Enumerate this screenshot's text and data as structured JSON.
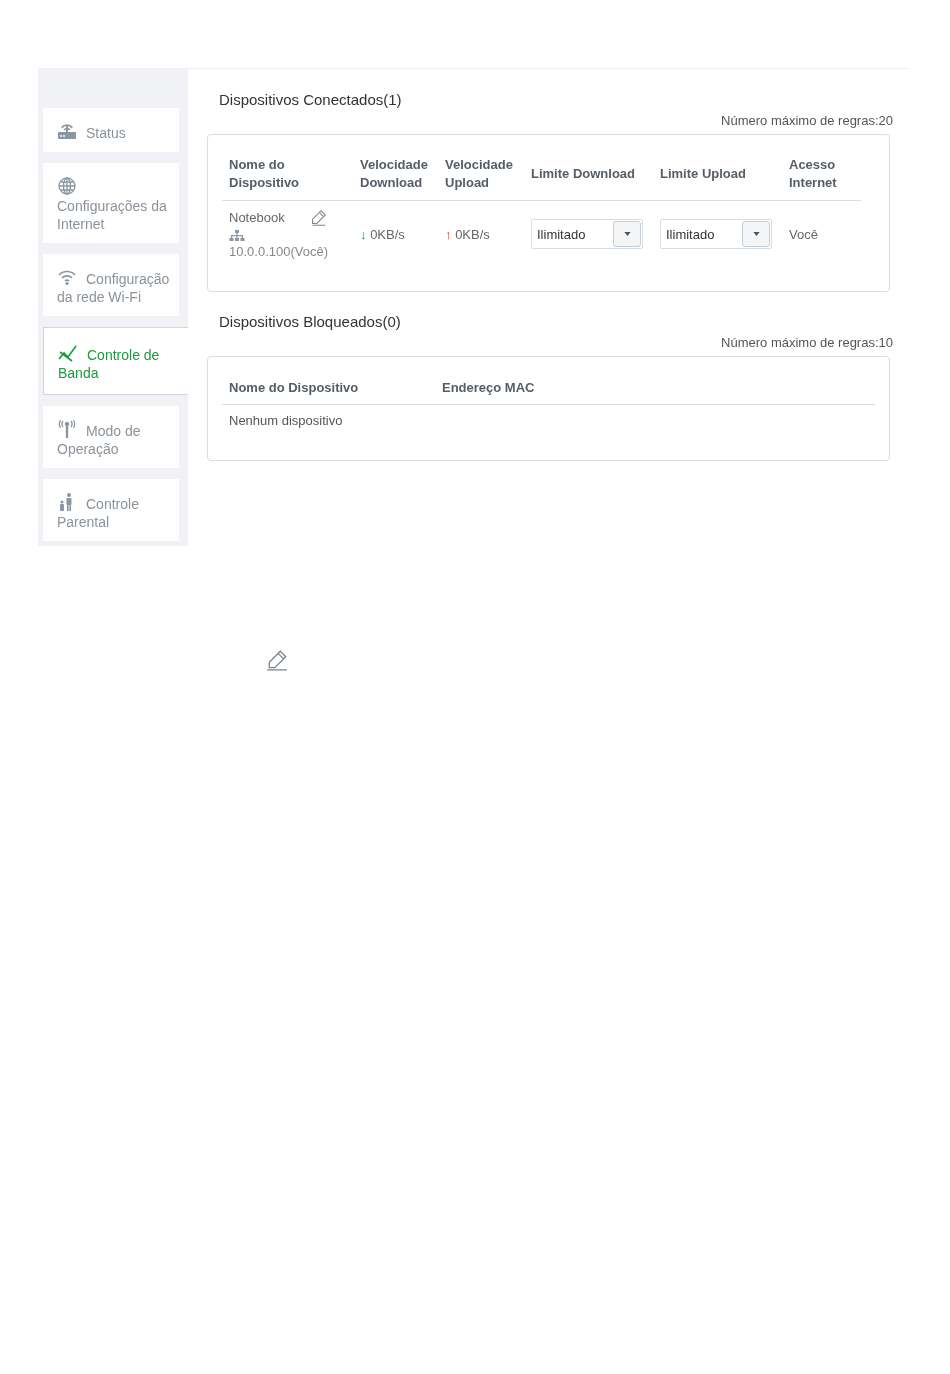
{
  "sidebar": {
    "items": [
      {
        "label": "Status",
        "selected": false
      },
      {
        "label": "Configurações da Internet",
        "selected": false
      },
      {
        "label": "Configuração da rede Wi-Fi",
        "selected": false
      },
      {
        "label": "Controle de Banda",
        "selected": true
      },
      {
        "label": "Modo de Operação",
        "selected": false
      },
      {
        "label": "Controle Parental",
        "selected": false
      }
    ]
  },
  "connected": {
    "title": "Dispositivos Conectados(1)",
    "max_rules": "Número máximo de regras:20",
    "columns": [
      "Nome do Dispositivo",
      "Velocidade Download",
      "Velocidade Upload",
      "Limite Download",
      "Limite Upload",
      "Acesso Internet"
    ],
    "rows": [
      {
        "name": "Notebook",
        "ip": "10.0.0.100(Você)",
        "download_arrow": "↓",
        "download": "0KB/s",
        "upload_arrow": "↑",
        "upload": "0KB/s",
        "limit_download": "Ilimitado",
        "limit_upload": "Ilimitado",
        "access": "Você"
      }
    ]
  },
  "blocked": {
    "title": "Dispositivos Bloqueados(0)",
    "max_rules": "Número máximo de regras:10",
    "columns": [
      "Nome do Dispositivo",
      "Endereço MAC"
    ],
    "empty_text": "Nenhum dispositivo"
  }
}
